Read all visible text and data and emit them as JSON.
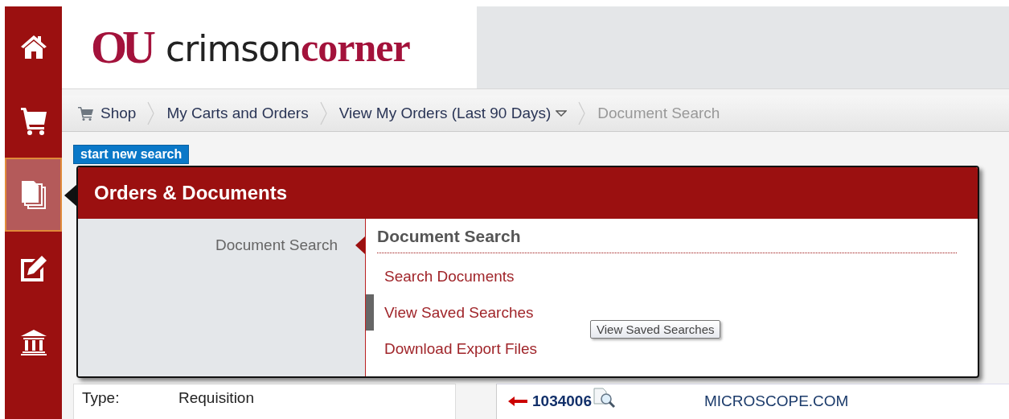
{
  "sidebar": {
    "items": [
      {
        "kind": "home",
        "selected": false
      },
      {
        "kind": "cart",
        "selected": false
      },
      {
        "kind": "documents",
        "selected": true
      },
      {
        "kind": "edit",
        "selected": false
      },
      {
        "kind": "bank",
        "selected": false
      }
    ]
  },
  "header": {
    "logo": {
      "mark": "OU",
      "text_1": "crimson",
      "text_2": "corner"
    }
  },
  "breadcrumb": [
    {
      "label": "Shop",
      "kind": "shop",
      "dropdown": false,
      "current": false
    },
    {
      "label": "My Carts and Orders",
      "kind": "link",
      "dropdown": false,
      "current": false
    },
    {
      "label": "View My Orders (Last 90 Days)",
      "kind": "link",
      "dropdown": true,
      "current": false
    },
    {
      "label": "Document Search",
      "kind": "link",
      "dropdown": false,
      "current": true
    }
  ],
  "start_button": "start new search",
  "details": [
    {
      "label": "Type:",
      "value": "Requisition"
    }
  ],
  "results": [
    {
      "number": "1034006",
      "supplier": "MICROSCOPE.COM"
    }
  ],
  "popup": {
    "title": "Orders & Documents",
    "left_items": [
      {
        "label": "Document Search",
        "selected": true
      }
    ],
    "section_title": "Document Search",
    "links": [
      {
        "label": "Search Documents",
        "hovered": false
      },
      {
        "label": "View Saved Searches",
        "hovered": true
      },
      {
        "label": "Download Export Files",
        "hovered": false
      }
    ],
    "tooltip": "View Saved Searches"
  }
}
